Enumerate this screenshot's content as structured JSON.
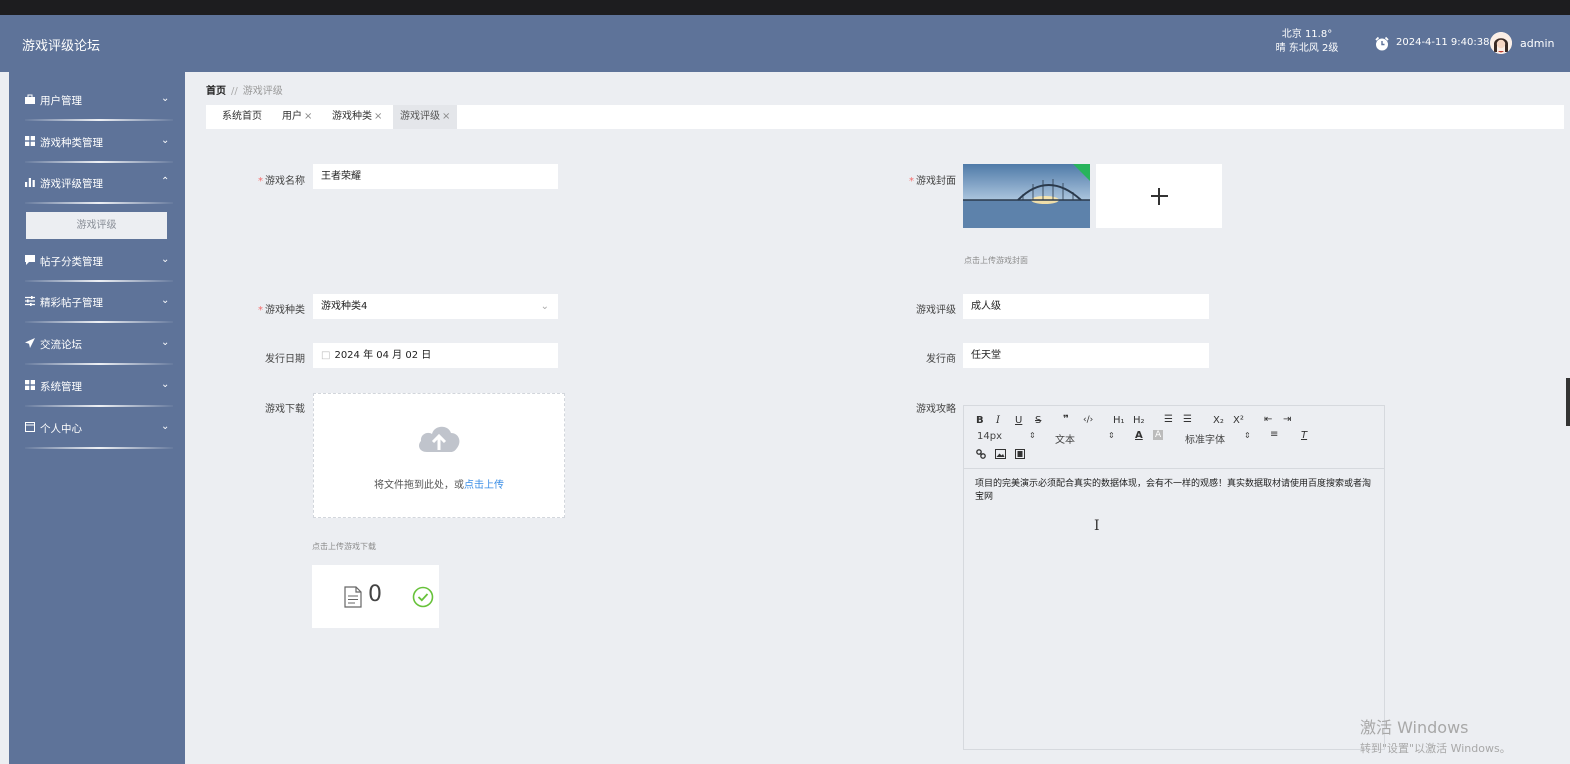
{
  "header": {
    "brand": "游戏评级论坛",
    "weather_line1": "北京 11.8°",
    "weather_line2": "晴 东北风 2级",
    "datetime": "2024-4-11 9:40:38",
    "username": "admin"
  },
  "sidebar": {
    "items": [
      {
        "label": "用户管理",
        "icon": "briefcase-icon",
        "chevron": "chevron-down"
      },
      {
        "label": "游戏种类管理",
        "icon": "grid-icon",
        "chevron": "chevron-down"
      },
      {
        "label": "游戏评级管理",
        "icon": "bar-chart-icon",
        "chevron": "chevron-up"
      },
      {
        "label": "帖子分类管理",
        "icon": "comment-icon",
        "chevron": "chevron-down"
      },
      {
        "label": "精彩帖子管理",
        "icon": "sliders-icon",
        "chevron": "chevron-down"
      },
      {
        "label": "交流论坛",
        "icon": "paper-plane-icon",
        "chevron": "chevron-down"
      },
      {
        "label": "系统管理",
        "icon": "grid-icon",
        "chevron": "chevron-down"
      },
      {
        "label": "个人中心",
        "icon": "window-icon",
        "chevron": "chevron-down"
      }
    ],
    "sub_item": "游戏评级"
  },
  "breadcrumb": {
    "home": "首页",
    "separator": "//",
    "current": "游戏评级"
  },
  "tabs": [
    {
      "label": "系统首页",
      "closable": false
    },
    {
      "label": "用户",
      "closable": true
    },
    {
      "label": "游戏种类",
      "closable": true
    },
    {
      "label": "游戏评级",
      "closable": true,
      "active": true
    }
  ],
  "tab_close_glyph": "×",
  "form": {
    "game_name_label": "游戏名称",
    "game_name_value": "王者荣耀",
    "cover_label": "游戏封面",
    "cover_hint": "点击上传游戏封面",
    "game_type_label": "游戏种类",
    "game_type_value": "游戏种类4",
    "rating_label": "游戏评级",
    "rating_value": "成人级",
    "release_date_label": "发行日期",
    "release_date_value": "2024 年 04 月 02 日",
    "publisher_label": "发行商",
    "publisher_value": "任天堂",
    "download_label": "游戏下载",
    "upload_text": "将文件拖到此处，或",
    "upload_link": "点击上传",
    "download_hint": "点击上传游戏下载",
    "file_count": "0",
    "guide_label": "游戏攻略",
    "required_mark": "*"
  },
  "editor": {
    "toolbar_row1": [
      "B",
      "I",
      "U",
      "S",
      "❞",
      "‹/›",
      "H₁",
      "H₂",
      "☰",
      "☰",
      "X₂",
      "X²",
      "⇤",
      "⇥"
    ],
    "font_size": "14px",
    "text_style": "文本",
    "font_family": "标准字体",
    "content": "项目的完美演示必须配合真实的数据体现，会有不一样的观感！真实数据取材请使用百度搜索或者淘宝网"
  },
  "watermark": {
    "line1": "激活 Windows",
    "line2": "转到\"设置\"以激活 Windows。"
  },
  "colors": {
    "header_bg": "#5e7399",
    "sidebar_bg": "#5e7399",
    "page_bg": "#eceef2",
    "required": "#f56c6c",
    "link": "#3a8ee6",
    "success": "#67c23a"
  }
}
